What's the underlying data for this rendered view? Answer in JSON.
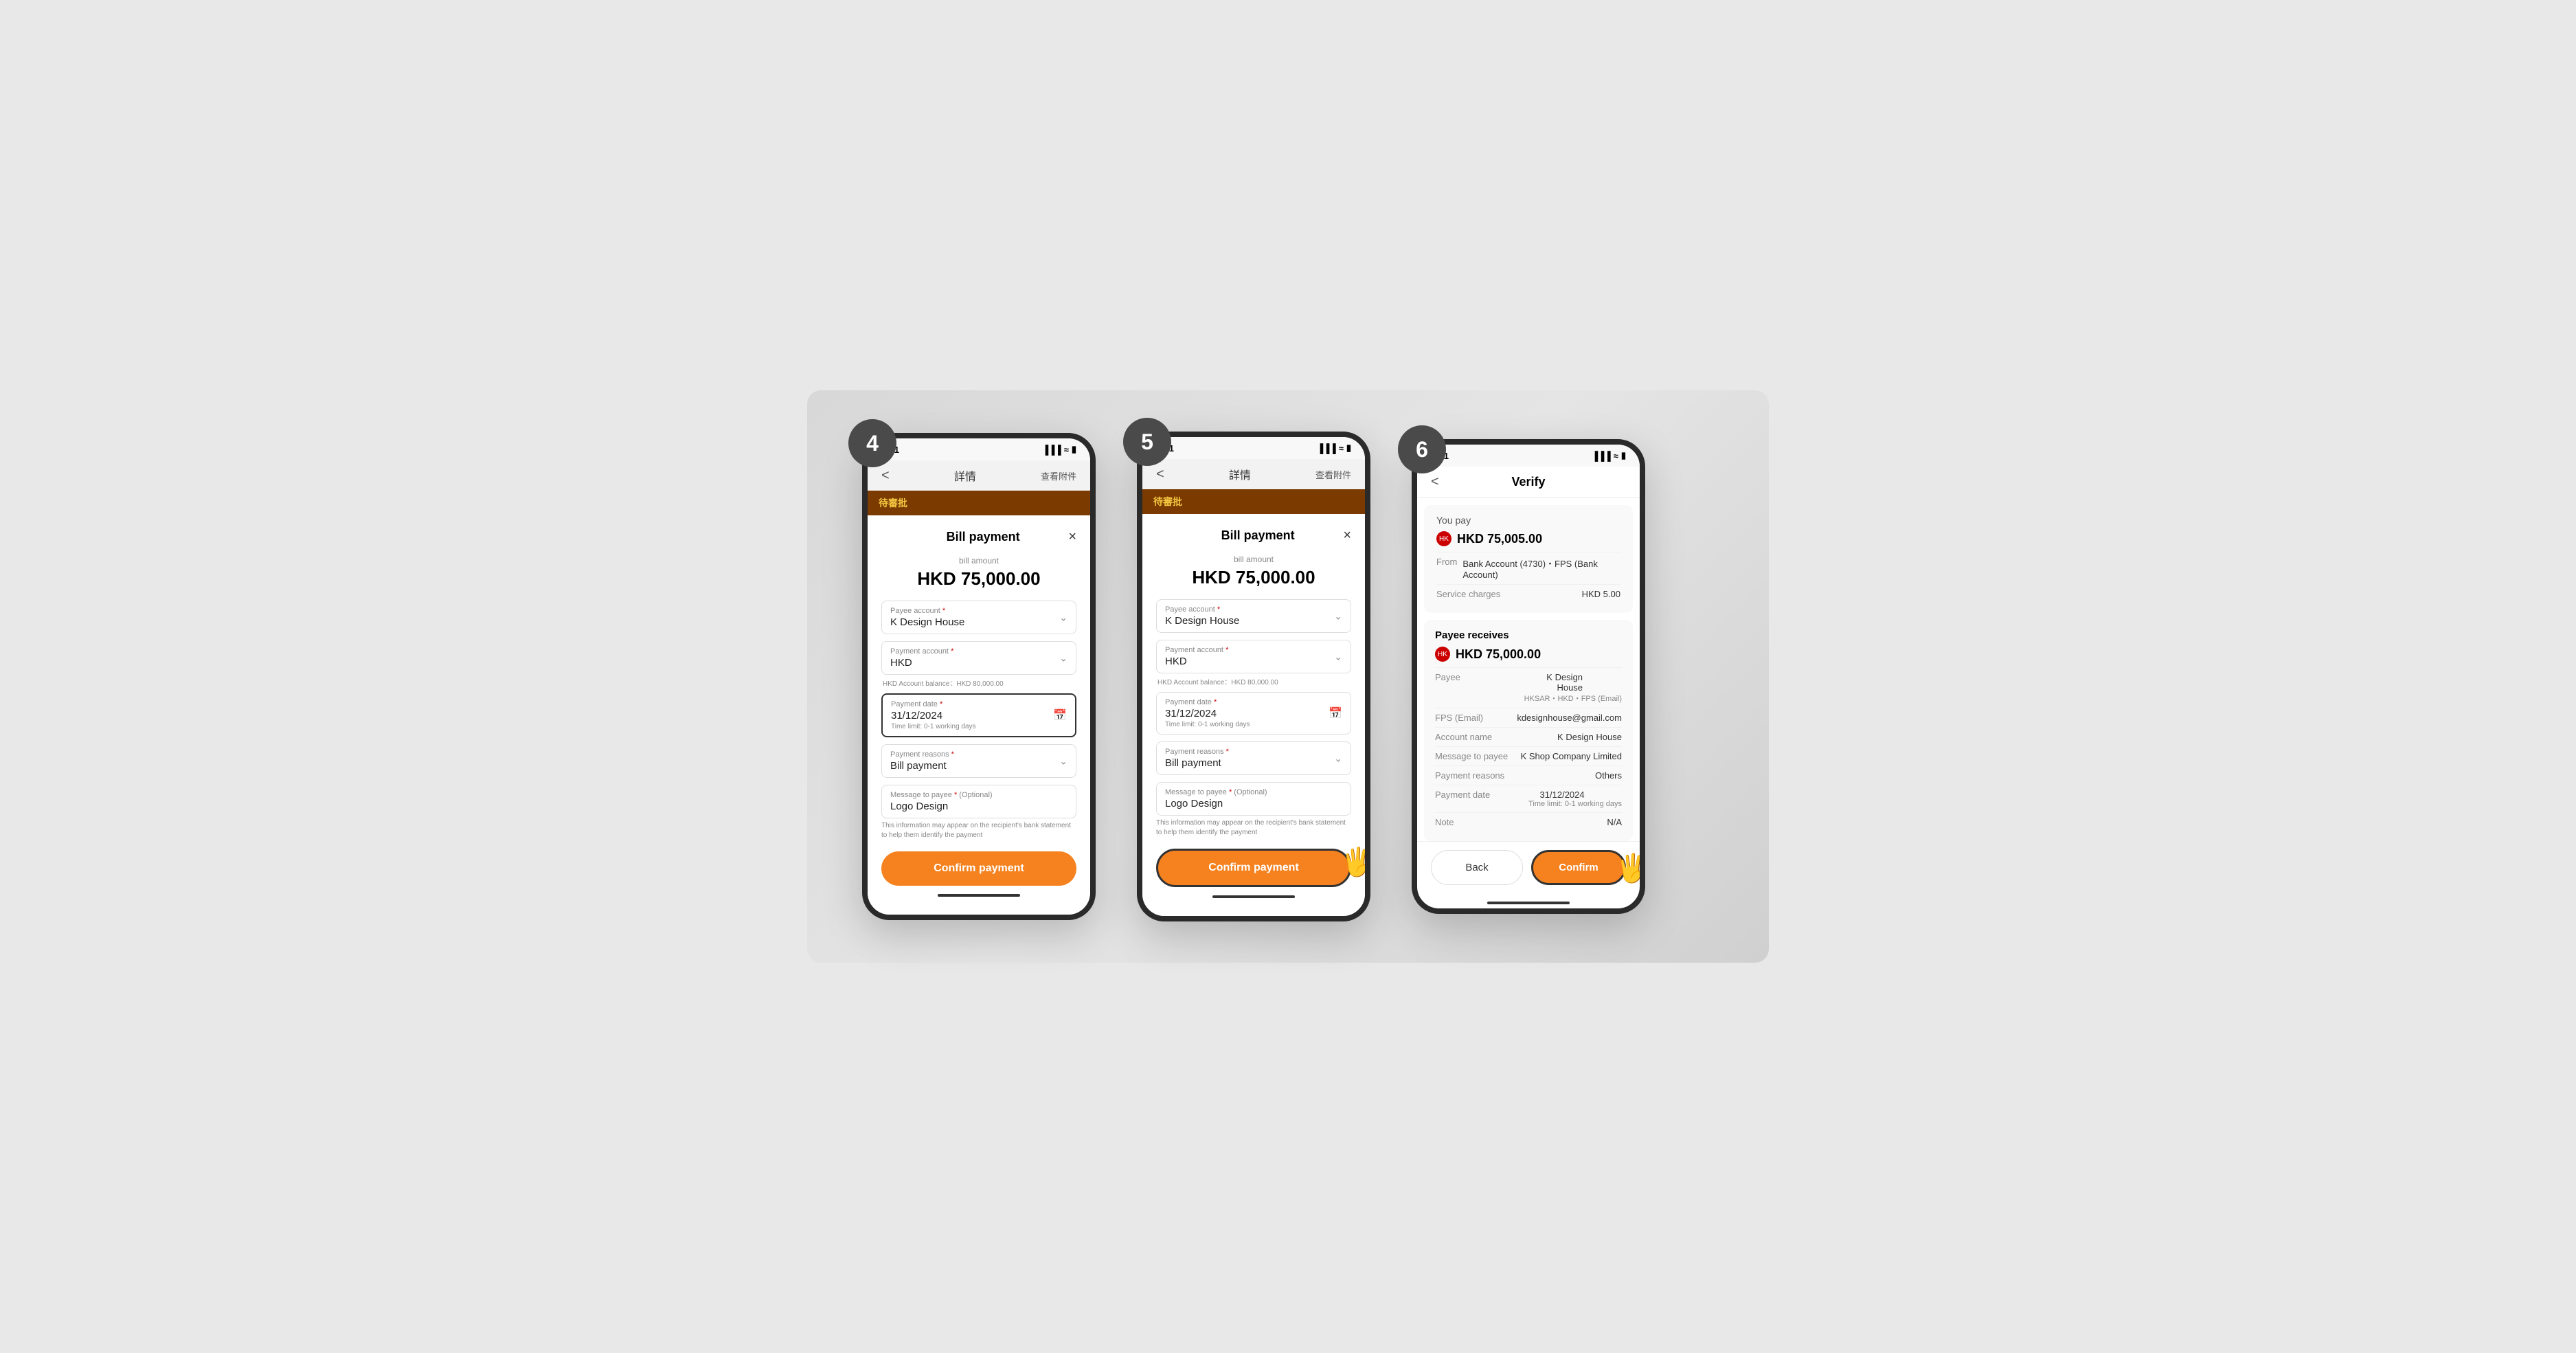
{
  "background": {
    "color": "#e0e0e0"
  },
  "steps": [
    {
      "number": "4",
      "screen": "bill-payment-form",
      "status_bar": {
        "time": "9:41",
        "signal": "▪▪▪",
        "wifi": "wifi",
        "battery": "battery"
      },
      "nav": {
        "back": "<",
        "title": "詳情",
        "action": "查看附件"
      },
      "pending_banner": "待審批",
      "modal": {
        "title": "Bill payment",
        "close": "×",
        "bill_amount_label": "bill amount",
        "bill_amount": "HKD 75,000.00",
        "fields": [
          {
            "label": "Payee account",
            "required": true,
            "value": "K Design House",
            "type": "dropdown"
          },
          {
            "label": "Payment account",
            "required": true,
            "value": "HKD",
            "type": "dropdown",
            "balance": "HKD Account balance：HKD 80,000.00"
          },
          {
            "label": "Payment date",
            "required": true,
            "value": "31/12/2024",
            "type": "date",
            "time_limit": "Time limit: 0-1 working days",
            "highlighted": true
          },
          {
            "label": "Payment reasons",
            "required": true,
            "value": "Bill payment",
            "type": "dropdown"
          },
          {
            "label": "Message to payee",
            "required": true,
            "optional": "(Optional)",
            "value": "Logo Design",
            "type": "text",
            "hint": "This information may appear on the recipient's bank statement to help them identify the payment"
          }
        ],
        "confirm_btn": "Confirm payment"
      }
    },
    {
      "number": "5",
      "screen": "bill-payment-form",
      "status_bar": {
        "time": "9:41",
        "signal": "▪▪▪",
        "wifi": "wifi",
        "battery": "battery"
      },
      "nav": {
        "back": "<",
        "title": "詳情",
        "action": "查看附件"
      },
      "pending_banner": "待審批",
      "modal": {
        "title": "Bill payment",
        "close": "×",
        "bill_amount_label": "bill amount",
        "bill_amount": "HKD 75,000.00",
        "fields": [
          {
            "label": "Payee account",
            "required": true,
            "value": "K Design House",
            "type": "dropdown"
          },
          {
            "label": "Payment account",
            "required": true,
            "value": "HKD",
            "type": "dropdown",
            "balance": "HKD Account balance：HKD 80,000.00"
          },
          {
            "label": "Payment date",
            "required": true,
            "value": "31/12/2024",
            "type": "date",
            "time_limit": "Time limit: 0-1 working days"
          },
          {
            "label": "Payment reasons",
            "required": true,
            "value": "Bill payment",
            "type": "dropdown"
          },
          {
            "label": "Message to payee",
            "required": true,
            "optional": "(Optional)",
            "value": "Logo Design",
            "type": "text",
            "hint": "This information may appear on the recipient's bank statement to help them identify the payment"
          }
        ],
        "confirm_btn": "Confirm payment",
        "confirm_btn_highlighted": true
      },
      "has_cursor": true
    },
    {
      "number": "6",
      "screen": "verify",
      "status_bar": {
        "time": "9:41",
        "signal": "▪▪▪",
        "wifi": "wifi",
        "battery": "battery"
      },
      "nav": {
        "back": "<",
        "title": "Verify"
      },
      "you_pay": {
        "section_title": "You pay",
        "amount": "HKD 75,005.00",
        "from_label": "From",
        "from_value": "Bank Account (4730)・FPS (Bank Account)",
        "service_charges_label": "Service charges",
        "service_charges_value": "HKD 5.00"
      },
      "payee_receives": {
        "section_title": "Payee receives",
        "amount": "HKD 75,000.00",
        "rows": [
          {
            "label": "Payee",
            "value": "K Design House",
            "sub": "HKSAR・HKD・FPS (Email)"
          },
          {
            "label": "FPS (Email)",
            "value": "kdesignhouse@gmail.com",
            "sub": ""
          },
          {
            "label": "Account name",
            "value": "K Design House",
            "sub": ""
          },
          {
            "label": "Message to payee",
            "value": "K Shop Company Limited",
            "sub": ""
          },
          {
            "label": "Payment reasons",
            "value": "Others",
            "sub": ""
          },
          {
            "label": "Payment date",
            "value": "31/12/2024",
            "sub": "Time limit: 0-1 working days"
          },
          {
            "label": "Note",
            "value": "N/A",
            "sub": ""
          }
        ]
      },
      "actions": {
        "back": "Back",
        "confirm": "Confirm"
      },
      "has_cursor": true
    }
  ]
}
